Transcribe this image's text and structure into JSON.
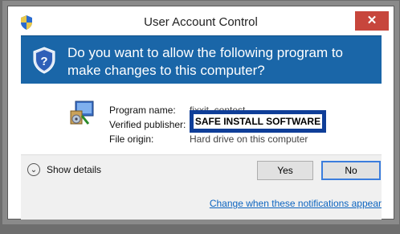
{
  "window": {
    "title": "User Account Control",
    "close_glyph": "✕"
  },
  "banner": {
    "question": "Do you want to allow the following program to make changes to this computer?"
  },
  "program": {
    "labels": {
      "name": "Program name:",
      "publisher": "Verified publisher:",
      "origin": "File origin:"
    },
    "values": {
      "name": "fixxit_contest",
      "origin": "Hard drive on this computer"
    },
    "redaction_label": "SAFE INSTALL SOFTWARE"
  },
  "footer": {
    "show_details": "Show details",
    "yes_button": "Yes",
    "no_button": "No",
    "notifications_link": "Change when these notifications appear"
  },
  "icons": [
    "shield-icon",
    "close-icon",
    "program-installer-icon",
    "chevron-down-icon"
  ],
  "colors": {
    "banner": "#1a66a8",
    "close": "#c7463c",
    "redaction": "#0f3e98",
    "link": "#0c64c0"
  }
}
